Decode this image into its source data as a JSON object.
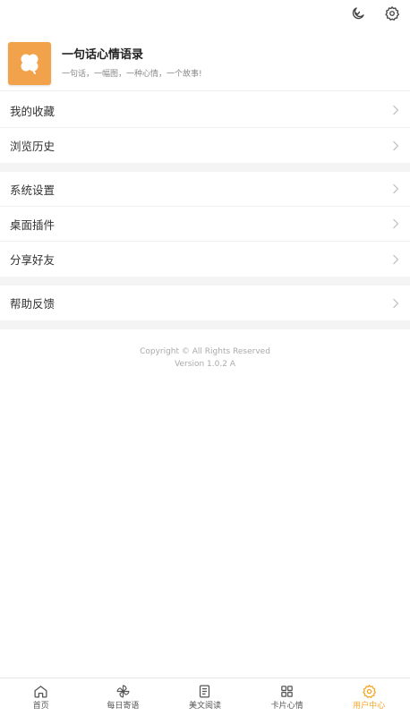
{
  "header": {
    "icons": [
      "moon-icon",
      "gear-icon"
    ]
  },
  "profile": {
    "title": "一句话心情语录",
    "subtitle": "一句话，一幅图，一种心情，一个故事!",
    "icon": "clover-icon",
    "icon_color": "#f2a24a"
  },
  "menu_groups": [
    {
      "items": [
        {
          "label": "我的收藏"
        },
        {
          "label": "浏览历史"
        }
      ]
    },
    {
      "items": [
        {
          "label": "系统设置"
        },
        {
          "label": "桌面插件"
        },
        {
          "label": "分享好友"
        }
      ]
    },
    {
      "items": [
        {
          "label": "帮助反馈"
        }
      ]
    }
  ],
  "copyright": {
    "line1": "Copyright © All Rights Reserved",
    "line2": "Version 1.0.2 A"
  },
  "tabbar": {
    "active_color": "#f5a623",
    "tabs": [
      {
        "label": "首页",
        "icon": "home-icon"
      },
      {
        "label": "每日寄语",
        "icon": "pinwheel-icon"
      },
      {
        "label": "美文阅读",
        "icon": "document-icon"
      },
      {
        "label": "卡片心情",
        "icon": "grid-icon"
      },
      {
        "label": "用户中心",
        "icon": "gear-icon",
        "active": true
      }
    ]
  }
}
